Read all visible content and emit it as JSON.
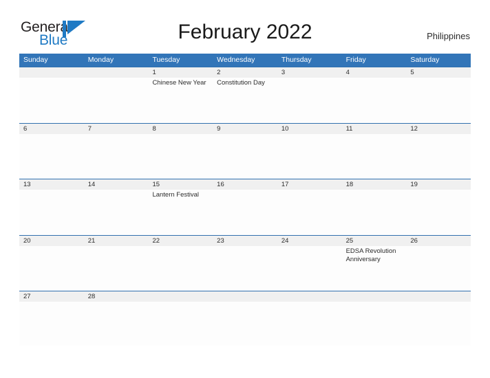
{
  "brand": {
    "name_part1": "General",
    "name_part2": "Blue",
    "accent_color": "#1f7ac4",
    "mark_icon": "flag-triangle-icon"
  },
  "header": {
    "title": "February 2022",
    "country": "Philippines"
  },
  "calendar": {
    "header_bg": "#3275b8",
    "row_divider_color": "#2f6fae",
    "datestrip_bg": "#f0f0f0",
    "weekdays": [
      "Sunday",
      "Monday",
      "Tuesday",
      "Wednesday",
      "Thursday",
      "Friday",
      "Saturday"
    ],
    "weeks": [
      [
        {
          "day": "",
          "event": ""
        },
        {
          "day": "",
          "event": ""
        },
        {
          "day": "1",
          "event": "Chinese New Year"
        },
        {
          "day": "2",
          "event": "Constitution Day"
        },
        {
          "day": "3",
          "event": ""
        },
        {
          "day": "4",
          "event": ""
        },
        {
          "day": "5",
          "event": ""
        }
      ],
      [
        {
          "day": "6",
          "event": ""
        },
        {
          "day": "7",
          "event": ""
        },
        {
          "day": "8",
          "event": ""
        },
        {
          "day": "9",
          "event": ""
        },
        {
          "day": "10",
          "event": ""
        },
        {
          "day": "11",
          "event": ""
        },
        {
          "day": "12",
          "event": ""
        }
      ],
      [
        {
          "day": "13",
          "event": ""
        },
        {
          "day": "14",
          "event": ""
        },
        {
          "day": "15",
          "event": "Lantern Festival"
        },
        {
          "day": "16",
          "event": ""
        },
        {
          "day": "17",
          "event": ""
        },
        {
          "day": "18",
          "event": ""
        },
        {
          "day": "19",
          "event": ""
        }
      ],
      [
        {
          "day": "20",
          "event": ""
        },
        {
          "day": "21",
          "event": ""
        },
        {
          "day": "22",
          "event": ""
        },
        {
          "day": "23",
          "event": ""
        },
        {
          "day": "24",
          "event": ""
        },
        {
          "day": "25",
          "event": "EDSA Revolution Anniversary"
        },
        {
          "day": "26",
          "event": ""
        }
      ],
      [
        {
          "day": "27",
          "event": ""
        },
        {
          "day": "28",
          "event": ""
        },
        {
          "day": "",
          "event": ""
        },
        {
          "day": "",
          "event": ""
        },
        {
          "day": "",
          "event": ""
        },
        {
          "day": "",
          "event": ""
        },
        {
          "day": "",
          "event": ""
        }
      ]
    ]
  }
}
